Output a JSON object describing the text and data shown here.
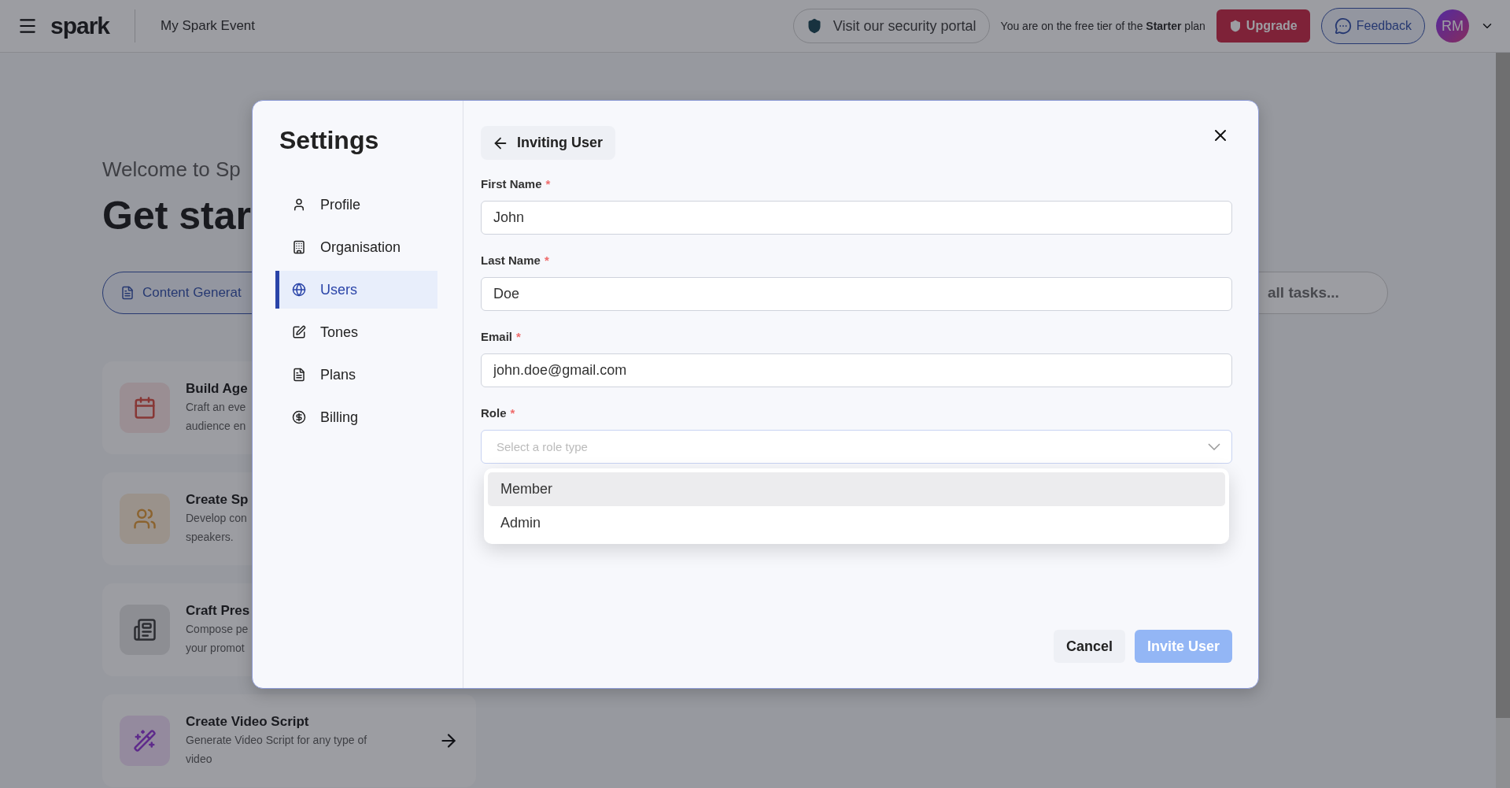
{
  "topbar": {
    "logo": "spark",
    "event_name": "My Spark Event",
    "security_link": "Visit our security portal",
    "tier_note": "You are on the free tier of the **Starter** plan",
    "upgrade_button": "Upgrade",
    "feedback_button": "Feedback",
    "avatar_initials": "RM"
  },
  "background": {
    "welcome": "Welcome to Sp",
    "heading": "Get star",
    "content_tab": "Content Generat",
    "search_placeholder": "all tasks...",
    "cards": [
      {
        "title": "Build Age",
        "lines": [
          "Craft an eve",
          "audience en"
        ]
      },
      {
        "title": "Create Sp",
        "lines": [
          "Develop con",
          "speakers."
        ]
      },
      {
        "title": "Craft Pres",
        "lines": [
          "Compose pe",
          "your promot"
        ]
      },
      {
        "title": "Create Video Script",
        "lines": [
          "Generate Video Script for any type of",
          "video"
        ]
      }
    ]
  },
  "settings": {
    "title": "Settings",
    "nav": [
      {
        "label": "Profile",
        "selected": false
      },
      {
        "label": "Organisation",
        "selected": false
      },
      {
        "label": "Users",
        "selected": true
      },
      {
        "label": "Tones",
        "selected": false
      },
      {
        "label": "Plans",
        "selected": false
      },
      {
        "label": "Billing",
        "selected": false
      }
    ],
    "page_title": "Inviting User",
    "fields": [
      {
        "label": "First Name",
        "required_mark": "*",
        "value": "John"
      },
      {
        "label": "Last Name",
        "required_mark": "*",
        "value": "Doe"
      },
      {
        "label": "Email",
        "required_mark": "*",
        "value": "john.doe@gmail.com"
      }
    ],
    "role": {
      "label": "Role",
      "required_mark": "*",
      "placeholder": "Select a role type",
      "options": [
        {
          "label": "Member",
          "selected": true
        },
        {
          "label": "Admin",
          "selected": false
        }
      ]
    },
    "buttons": {
      "cancel": "Cancel",
      "submit": "Invite User"
    }
  }
}
